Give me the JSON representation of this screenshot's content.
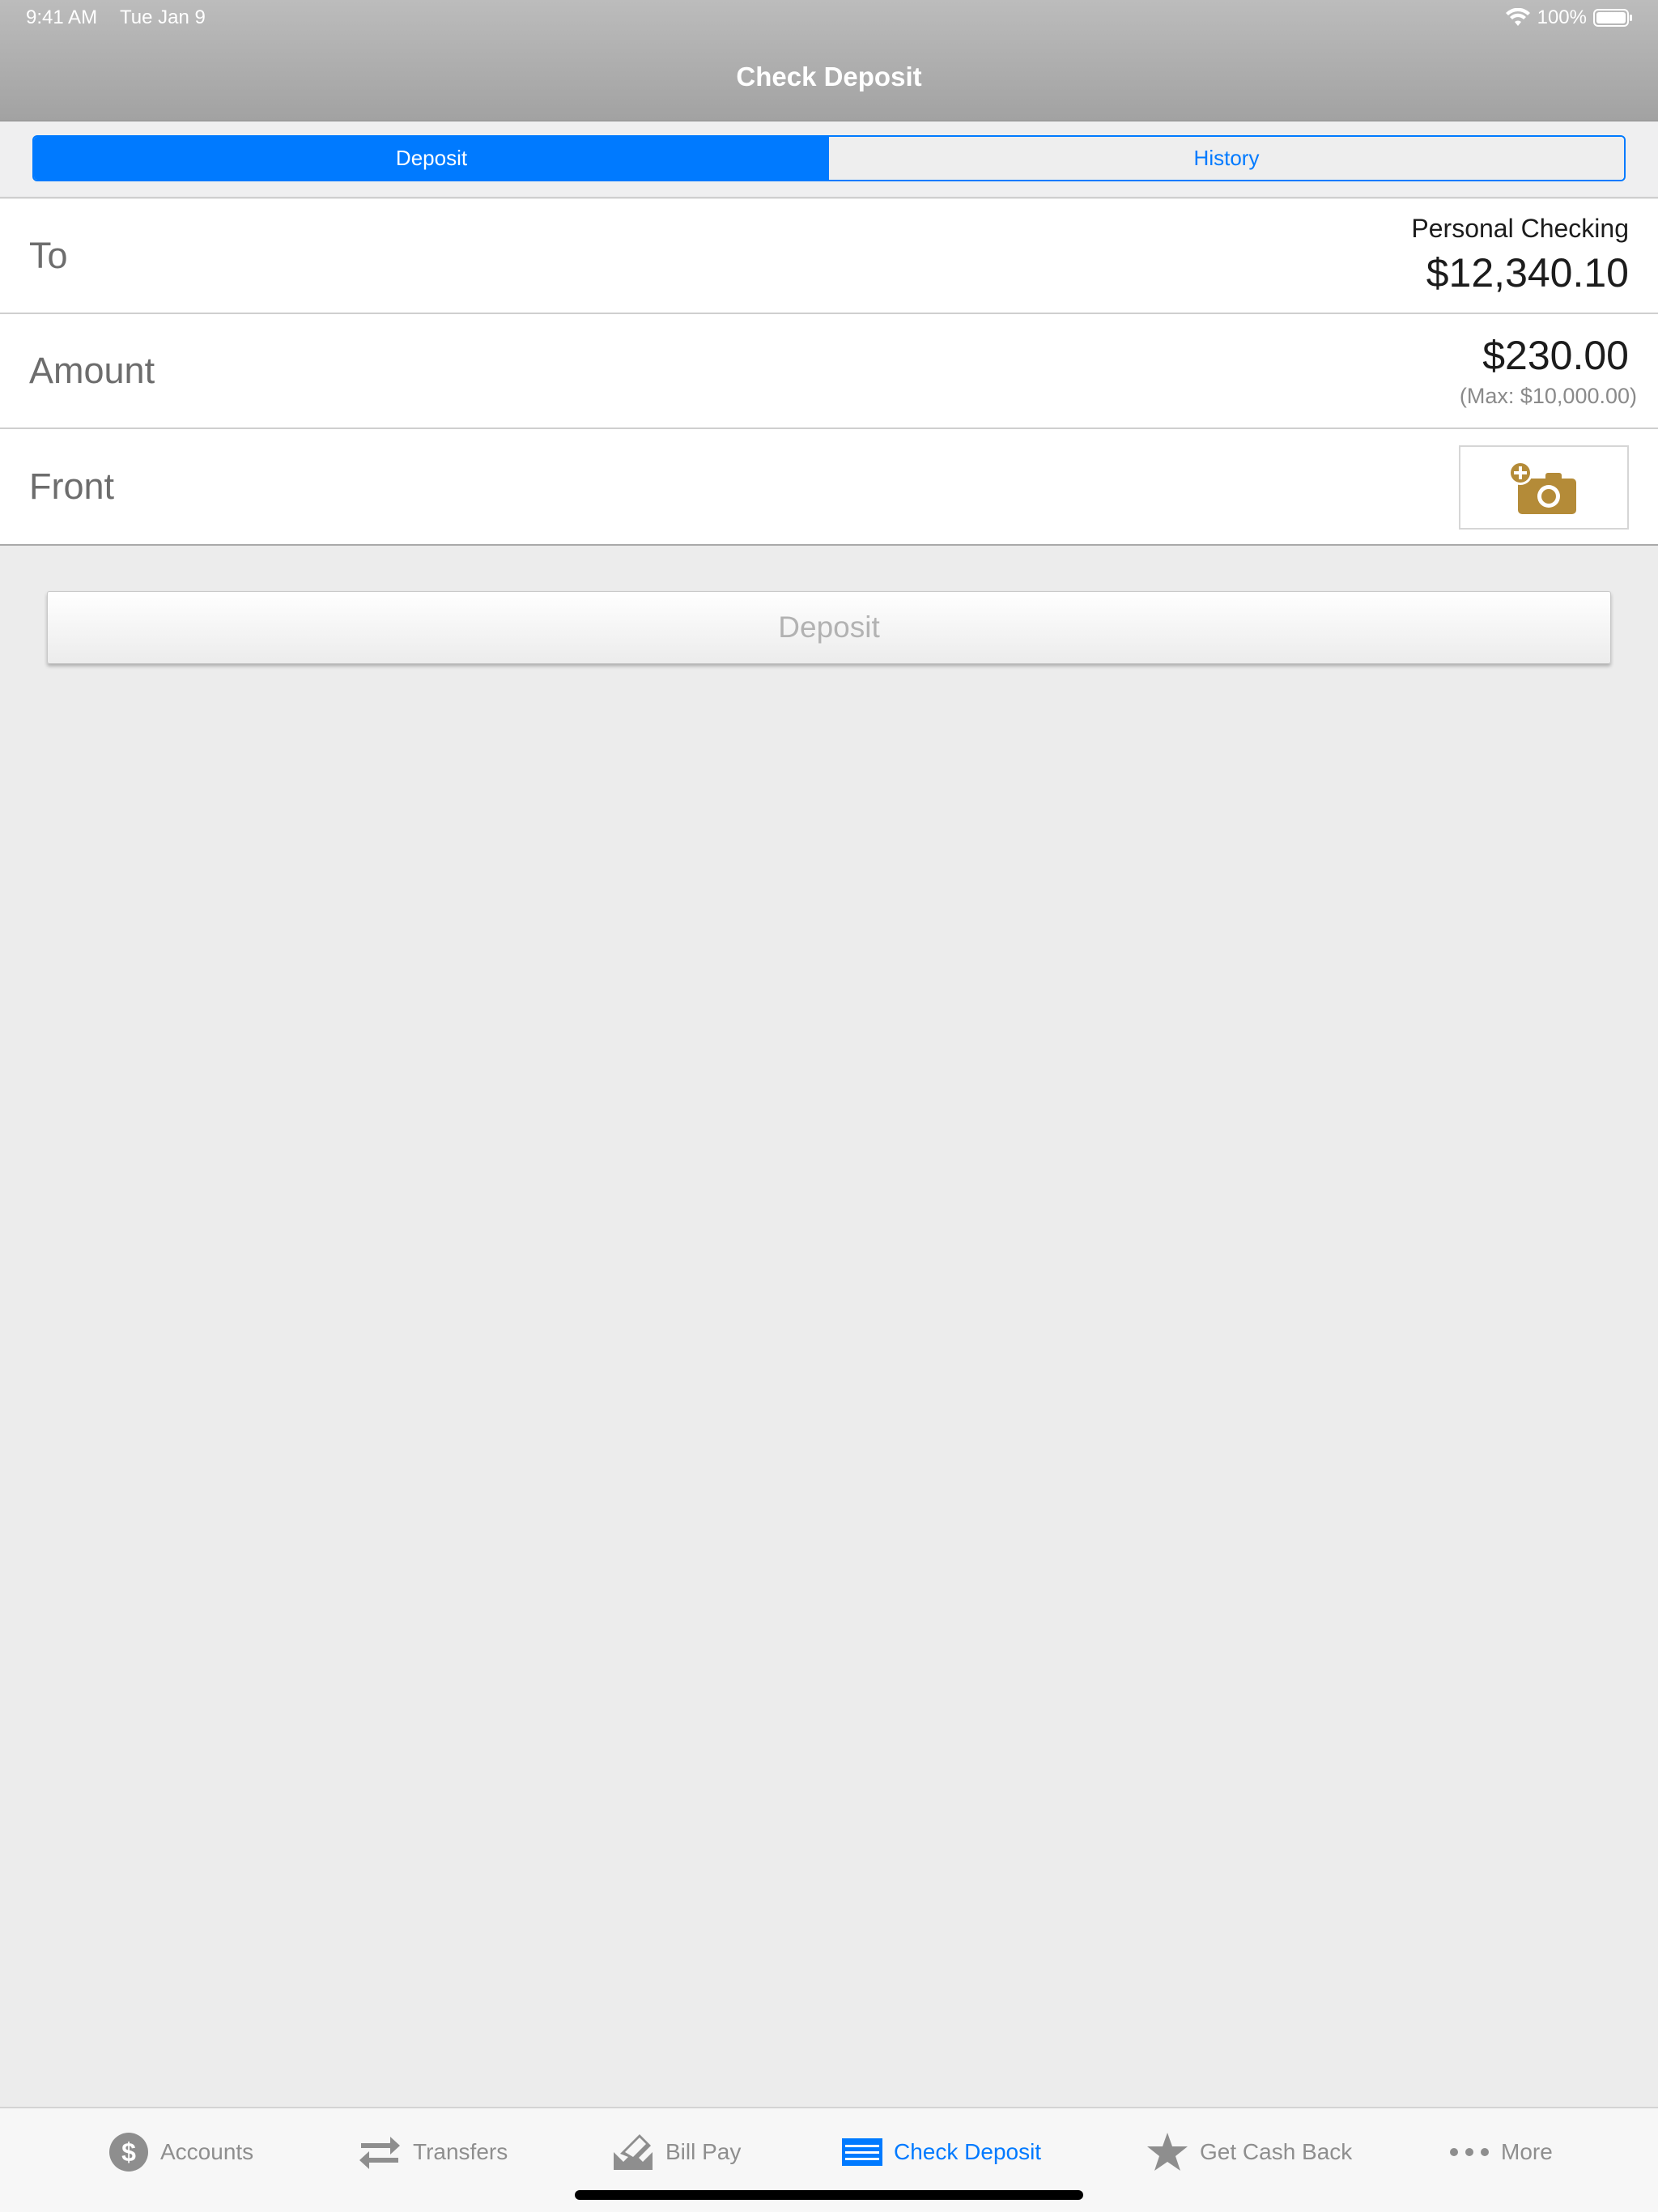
{
  "status_bar": {
    "time": "9:41 AM",
    "date": "Tue Jan 9",
    "battery": "100%"
  },
  "header": {
    "title": "Check Deposit"
  },
  "segments": {
    "deposit_label": "Deposit",
    "history_label": "History",
    "selected": "Deposit"
  },
  "form": {
    "to": {
      "label": "To",
      "account_name": "Personal Checking",
      "balance": "$12,340.10"
    },
    "amount": {
      "label": "Amount",
      "value": "$230.00",
      "max_note": "(Max: $10,000.00)"
    },
    "front": {
      "label": "Front",
      "icon": "add-camera-icon"
    }
  },
  "deposit_button": {
    "label": "Deposit"
  },
  "tabbar": {
    "items": [
      {
        "label": "Accounts",
        "icon": "dollar-circle-icon"
      },
      {
        "label": "Transfers",
        "icon": "transfer-arrows-icon"
      },
      {
        "label": "Bill Pay",
        "icon": "bill-pay-icon"
      },
      {
        "label": "Check Deposit",
        "icon": "check-icon"
      },
      {
        "label": "Get Cash Back",
        "icon": "star-icon"
      },
      {
        "label": "More",
        "icon": "more-dots-icon"
      }
    ],
    "active": "Check Deposit"
  },
  "colors": {
    "accent": "#007aff",
    "camera_icon": "#b48b38",
    "header_bg": "#aeaeae",
    "page_bg": "#ececec"
  }
}
